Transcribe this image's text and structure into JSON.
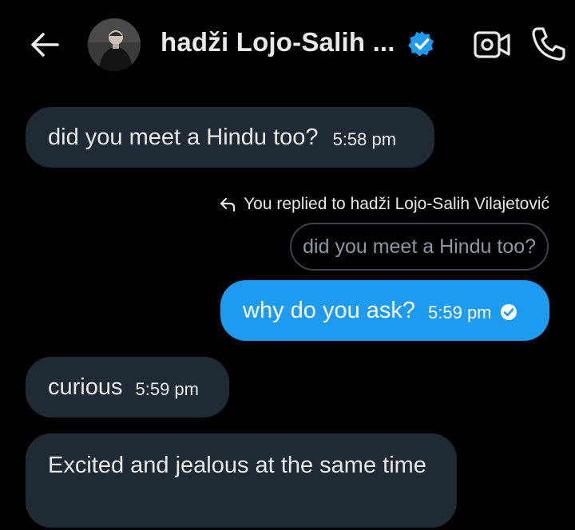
{
  "header": {
    "contact_name": "hadži Lojo-Salih ...",
    "verified": true,
    "accent_color": "#1d9bf0",
    "icons": [
      "back-arrow-icon",
      "verified-badge-icon",
      "video-call-icon",
      "phone-icon"
    ]
  },
  "messages": [
    {
      "direction": "incoming",
      "text": "did you meet a Hindu too?",
      "time": "5:58 pm"
    },
    {
      "direction": "outgoing",
      "reply_note": "You replied to hadži Lojo-Salih Vilajetović",
      "quoted_text": "did you meet a Hindu too?",
      "text": "why do you ask?",
      "time": "5:59 pm",
      "status": "read"
    },
    {
      "direction": "incoming",
      "text": "curious",
      "time": "5:59 pm"
    },
    {
      "direction": "incoming",
      "text": "Excited and jealous at the same time"
    }
  ],
  "colors": {
    "background": "#000000",
    "incoming_bubble": "#202a33",
    "outgoing_bubble": "#1d9bf0",
    "text": "#e7e9ea",
    "muted_text": "#8b98a5"
  }
}
